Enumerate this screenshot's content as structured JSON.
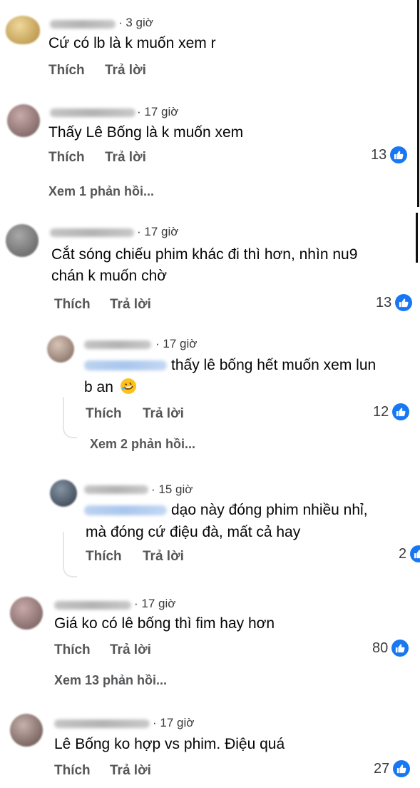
{
  "actions": {
    "like": "Thích",
    "reply": "Trả lời"
  },
  "comments": [
    {
      "time": "· 3 giờ",
      "text": "Cứ có lb là k muốn xem r",
      "reactions": ""
    },
    {
      "time": "· 17 giờ",
      "text": "Thấy Lê Bống là k muốn xem",
      "reactions": "13",
      "view_replies": "Xem 1 phản hồi..."
    },
    {
      "time": "· 17 giờ",
      "text": "Cắt sóng chiếu phim khác đi thì hơn, nhìn nu9 chán k muốn chờ",
      "reactions": "13"
    },
    {
      "time": "· 17 giờ",
      "text_line1": "thấy lê bống hết muốn xem lun",
      "text_line2": "b an",
      "emoji": "rolling-on-floor-laughing",
      "reactions": "12",
      "view_replies": "Xem 2 phản hồi..."
    },
    {
      "time": "· 15 giờ",
      "text_line1": "dạo này đóng phim nhiều nhỉ,",
      "text_line2": "mà đóng cứ điệu đà, mất cả hay",
      "reactions": "2"
    },
    {
      "time": "· 17 giờ",
      "text": "Giá ko có lê bống thì fim hay hơn",
      "reactions": "80",
      "view_replies": "Xem 13 phản hồi..."
    },
    {
      "time": "· 17 giờ",
      "text": "Lê Bống ko hợp vs phim. Điệu quá",
      "reactions": "27"
    }
  ],
  "icons": {
    "like": "thumbs-up-icon",
    "like_color": "#1877f2"
  }
}
